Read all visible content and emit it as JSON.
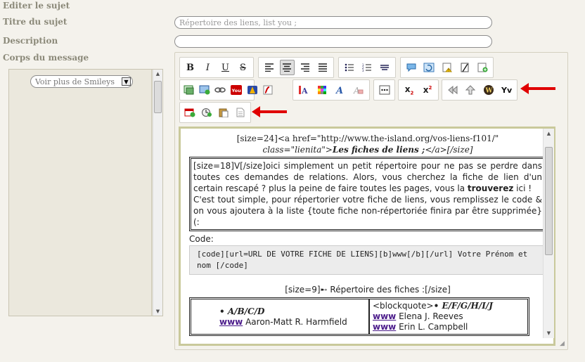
{
  "labels": {
    "edit_subject": "Editer le sujet",
    "subject_title": "Titre du sujet",
    "description": "Description",
    "message_body": "Corps du message"
  },
  "fields": {
    "title_value": "Répertoire des liens, list you ;",
    "description_value": ""
  },
  "smileys": {
    "select_label": "Voir plus de Smileys"
  },
  "content": {
    "title_a": "[size=24]<a href=\"http://www.the-island.org/vos-liens-f101/\"",
    "title_b_class": "class=\"lienita\">",
    "title_b_bold": "Les fiches de liens ;",
    "title_b_end": "</a>[/size]",
    "intro_1": "[size=18]V[/size]oici simplement un petit répertoire pour ne pas se perdre dans toutes ces demandes de relations. Alors, vous cherchez la fiche de lien d'un certain rescapé ? plus la peine de faire toutes les pages, vous la ",
    "intro_bold": "trouverez",
    "intro_2": " ici !",
    "intro_3": "C'est tout simple, pour répertorier votre fiche de liens, vous remplissez le code & on vous ajoutera à la liste {toute fiche non-répertoriée finira par être supprimée} (:",
    "code_label": "Code:",
    "code_text": "[code][url=URL DE VOTRE FICHE DE LIENS][b]www[/b][/url] Votre Prénom et nom [/code]",
    "separator": "[size=9]➸ Répertoire des fiches :[/size]",
    "left_title": "• A/B/C/D",
    "left_www": "www",
    "left_name": "Aaron-Matt R. Harmfield",
    "right_title_prefix": "<blockquote>",
    "right_title": "• E/F/G/H/I/J",
    "right_www_1": "www",
    "right_name_1": "Elena J. Reeves",
    "right_www_2": "www",
    "right_name_2": "Erin L. Campbell"
  },
  "colors": {
    "arrow": "#e00000",
    "editor_border": "#c9c99b",
    "link": "#4a1a8a"
  }
}
